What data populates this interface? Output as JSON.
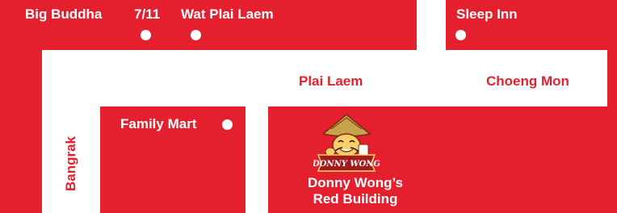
{
  "colors": {
    "brand_red": "#e5202e",
    "road": "#ffffff"
  },
  "landmarks": {
    "big_buddha": "Big Buddha",
    "seven_eleven": "7/11",
    "wat_plai_laem": "Wat Plai Laem",
    "sleep_inn": "Sleep Inn",
    "family_mart": "Family Mart"
  },
  "roads": {
    "plai_laem": "Plai Laem",
    "choeng_mon": "Choeng Mon",
    "bangrak": "Bangrak"
  },
  "destination": {
    "name_line1": "Donny Wong’s",
    "name_line2": "Red Building",
    "logo_text": "DONNY WONG",
    "logo_icon": "donny-wong-mascot-logo"
  },
  "icons": {
    "landmark_marker": "white-dot-marker"
  }
}
